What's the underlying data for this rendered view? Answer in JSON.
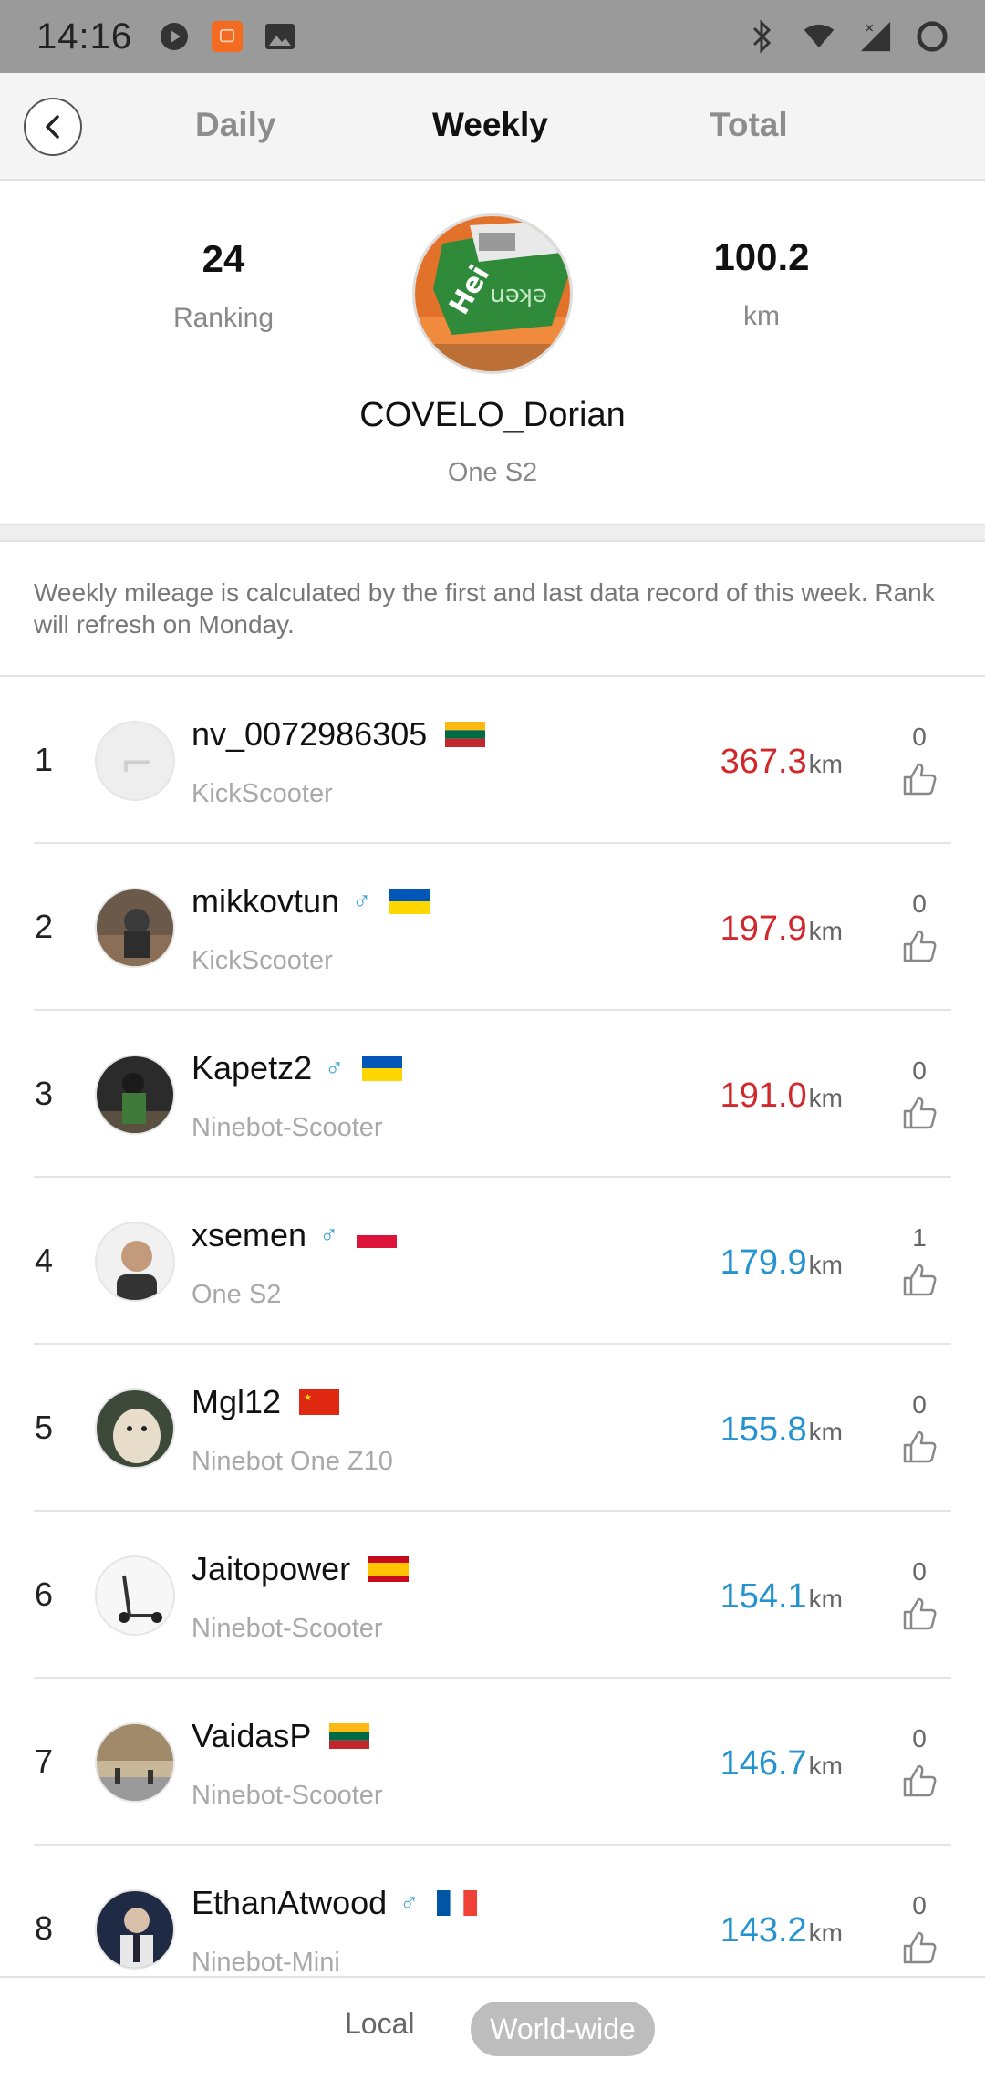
{
  "status_bar": {
    "time": "14:16"
  },
  "nav": {
    "tabs": [
      {
        "label": "Daily"
      },
      {
        "label": "Weekly"
      },
      {
        "label": "Total"
      }
    ],
    "active_tab": "Weekly"
  },
  "profile": {
    "ranking_value": "24",
    "ranking_label": "Ranking",
    "distance_value": "100.2",
    "distance_label": "km",
    "name": "COVELO_Dorian",
    "model": "One S2"
  },
  "note": "Weekly mileage is calculated by the first and last data record of this week. Rank will refresh on Monday.",
  "leaderboard": [
    {
      "rank": "1",
      "name": "nv_0072986305",
      "gender": "",
      "flag": "lithuania",
      "model": "KickScooter",
      "distance": "367.3",
      "unit": "km",
      "likes": "0",
      "color": "#d0282b"
    },
    {
      "rank": "2",
      "name": "mikkovtun",
      "gender": "♂",
      "flag": "ukraine",
      "model": "KickScooter",
      "distance": "197.9",
      "unit": "km",
      "likes": "0",
      "color": "#d0282b"
    },
    {
      "rank": "3",
      "name": "Kapetz2",
      "gender": "♂",
      "flag": "ukraine",
      "model": "Ninebot-Scooter",
      "distance": "191.0",
      "unit": "km",
      "likes": "0",
      "color": "#d0282b"
    },
    {
      "rank": "4",
      "name": "xsemen",
      "gender": "♂",
      "flag": "poland",
      "model": "One S2",
      "distance": "179.9",
      "unit": "km",
      "likes": "1",
      "color": "#2593d0"
    },
    {
      "rank": "5",
      "name": "Mgl12",
      "gender": "",
      "flag": "china",
      "model": "Ninebot One Z10",
      "distance": "155.8",
      "unit": "km",
      "likes": "0",
      "color": "#2593d0"
    },
    {
      "rank": "6",
      "name": "Jaitopower",
      "gender": "",
      "flag": "spain",
      "model": "Ninebot-Scooter",
      "distance": "154.1",
      "unit": "km",
      "likes": "0",
      "color": "#2593d0"
    },
    {
      "rank": "7",
      "name": "VaidasP",
      "gender": "",
      "flag": "lithuania",
      "model": "Ninebot-Scooter",
      "distance": "146.7",
      "unit": "km",
      "likes": "0",
      "color": "#2593d0"
    },
    {
      "rank": "8",
      "name": "EthanAtwood",
      "gender": "♂",
      "flag": "france",
      "model": "Ninebot-Mini",
      "distance": "143.2",
      "unit": "km",
      "likes": "0",
      "color": "#2593d0"
    }
  ],
  "bottom": {
    "local_label": "Local",
    "worldwide_label": "World-wide",
    "selected": "World-wide"
  }
}
